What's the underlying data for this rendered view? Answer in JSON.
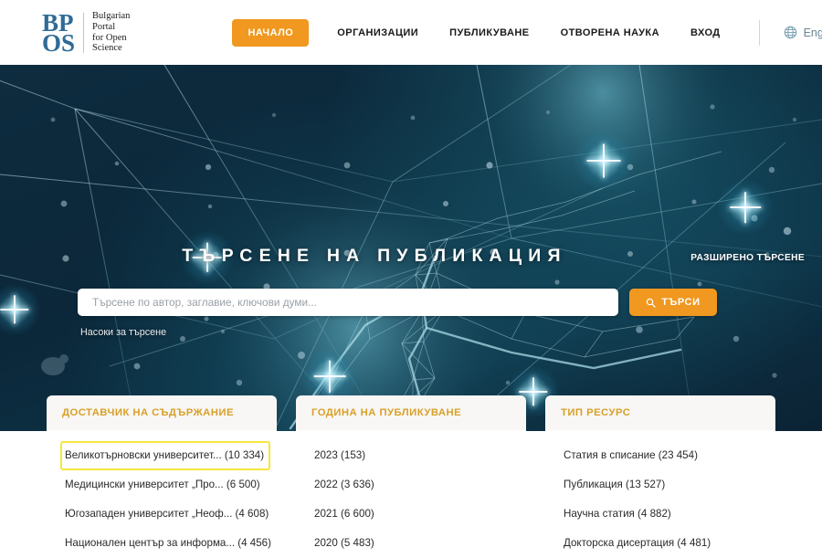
{
  "header": {
    "logo": {
      "mark_line1": "BP",
      "mark_line2": "OS",
      "text_line1": "Bulgarian",
      "text_line2": "Portal",
      "text_line3": "for Open",
      "text_line4": "Science"
    },
    "nav": [
      {
        "label": "НАЧАЛО",
        "active": true
      },
      {
        "label": "ОРГАНИЗАЦИИ",
        "active": false
      },
      {
        "label": "ПУБЛИКУВАНЕ",
        "active": false
      },
      {
        "label": "ОТВОРЕНА НАУКА",
        "active": false
      },
      {
        "label": "ВХОД",
        "active": false
      }
    ],
    "language": {
      "label": "English",
      "icon": "globe-icon"
    }
  },
  "hero": {
    "title": "ТЪРСЕНЕ НА ПУБЛИКАЦИЯ",
    "advanced_search": "РАЗШИРЕНО ТЪРСЕНЕ",
    "search_placeholder": "Търсене по автор, заглавие, ключови думи...",
    "search_value": "",
    "search_button": "ТЪРСИ",
    "search_button_icon": "magnifier-icon",
    "search_hint": "Насоки за търсене"
  },
  "facets": [
    {
      "title": "ДОСТАВЧИК НА СЪДЪРЖАНИЕ",
      "items": [
        {
          "label": "Великотърновски университет...  (10 334)",
          "highlight": true
        },
        {
          "label": "Медицински университет „Про...   (6 500)",
          "highlight": false
        },
        {
          "label": "Югозападен университет „Неоф... (4 608)",
          "highlight": false
        },
        {
          "label": "Национален център за информа... (4 456)",
          "highlight": false
        }
      ]
    },
    {
      "title": "ГОДИНА НА ПУБЛИКУВАНЕ",
      "items": [
        {
          "label": "2023 (153)",
          "highlight": false
        },
        {
          "label": "2022 (3 636)",
          "highlight": false
        },
        {
          "label": "2021 (6 600)",
          "highlight": false
        },
        {
          "label": "2020 (5 483)",
          "highlight": false
        }
      ]
    },
    {
      "title": "ТИП РЕСУРС",
      "items": [
        {
          "label": "Статия в списание (23 454)",
          "highlight": false
        },
        {
          "label": "Публикация (13 527)",
          "highlight": false
        },
        {
          "label": "Научна статия (4 882)",
          "highlight": false
        },
        {
          "label": "Докторска дисертация (4 481)",
          "highlight": false
        }
      ]
    }
  ],
  "colors": {
    "accent_orange": "#f0981f",
    "facet_title": "#d9a029",
    "highlight_yellow": "#f5e63c",
    "hero_dark": "#0b2739",
    "logo_blue": "#2f6b96"
  }
}
